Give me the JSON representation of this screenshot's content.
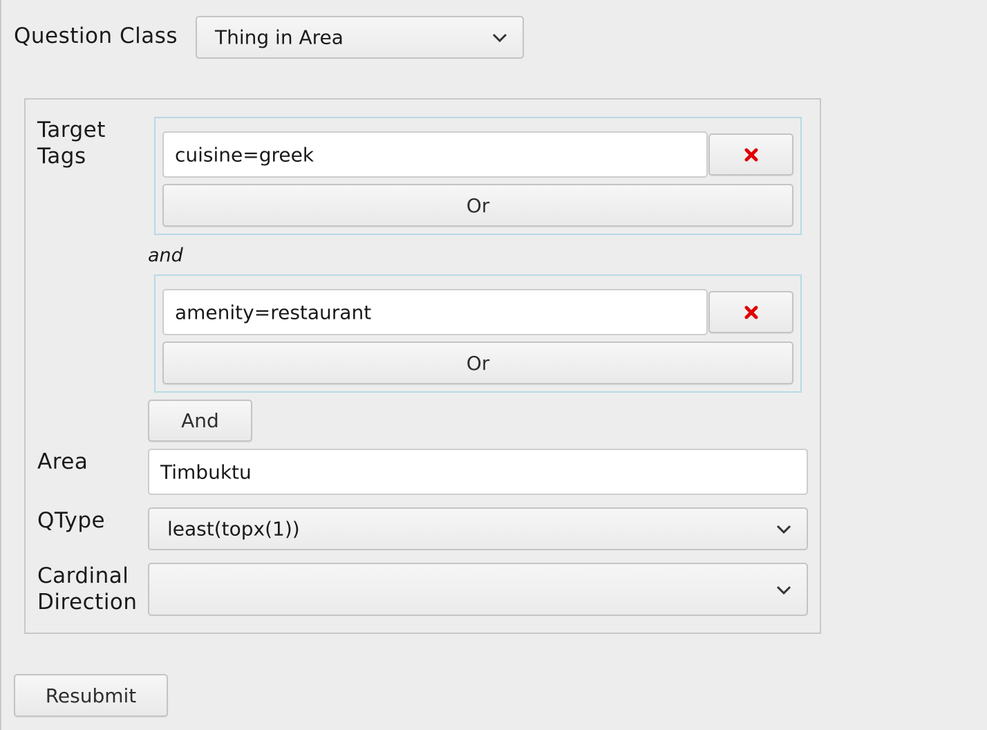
{
  "question_class": {
    "label": "Question Class",
    "selected": "Thing in Area"
  },
  "target_tags": {
    "label_line1": "Target",
    "label_line2": "Tags",
    "groups": [
      {
        "value": "cuisine=greek",
        "or_label": "Or"
      },
      {
        "value": "amenity=restaurant",
        "or_label": "Or"
      }
    ],
    "conjunction": "and",
    "and_button": "And",
    "remove_icon": "close-x-icon",
    "remove_color": "#e00000"
  },
  "area": {
    "label": "Area",
    "value": "Timbuktu"
  },
  "qtype": {
    "label": "QType",
    "selected": "least(topx(1))"
  },
  "cardinal_direction": {
    "label_line1": "Cardinal",
    "label_line2": "Direction",
    "selected": ""
  },
  "resubmit": {
    "label": "Resubmit"
  }
}
